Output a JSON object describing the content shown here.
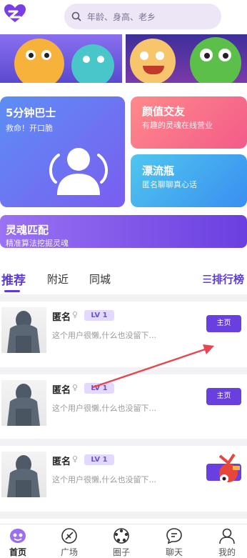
{
  "header": {
    "search_placeholder": "年龄、身高、老乡"
  },
  "cards": {
    "bus": {
      "title": "5分钟巴士",
      "subtitle": "救命！开口脆"
    },
    "looks": {
      "title": "颜值交友",
      "subtitle": "有趣的灵魂在线营业"
    },
    "bottle": {
      "title": "漂流瓶",
      "subtitle": "匿名聊聊真心话"
    },
    "soul": {
      "title": "灵魂匹配",
      "subtitle": "精准算法挖掘灵魂"
    }
  },
  "tabs": {
    "items": [
      "推荐",
      "附近",
      "同城"
    ],
    "active": "推荐",
    "rank_label": "☰排行榜"
  },
  "users": [
    {
      "name": "匿名",
      "gender_icon": "female-symbol-icon",
      "level": "LV 1",
      "bio": "这个用户很懒,什么也没留下...",
      "button": "主页"
    },
    {
      "name": "匿名",
      "gender_icon": "female-symbol-icon",
      "level": "LV 1",
      "bio": "这个用户很懒,什么也没留下...",
      "button": "主页"
    },
    {
      "name": "匿名",
      "gender_icon": "female-symbol-icon",
      "level": "LV 1",
      "bio": "这个用户很懒,什么也没留下...",
      "button": ""
    }
  ],
  "nav": {
    "items": [
      {
        "label": "首页",
        "icon": "home-face-icon",
        "active": true
      },
      {
        "label": "广场",
        "icon": "plaza-leaf-icon",
        "active": false
      },
      {
        "label": "圈子",
        "icon": "circle-icon",
        "active": false
      },
      {
        "label": "聊天",
        "icon": "chat-bubble-icon",
        "active": false
      },
      {
        "label": "我的",
        "icon": "person-icon",
        "active": false
      }
    ]
  },
  "colors": {
    "accent": "#6a3fe0",
    "search_bg": "#ede6f6",
    "annotation_arrow": "#e8454f"
  }
}
